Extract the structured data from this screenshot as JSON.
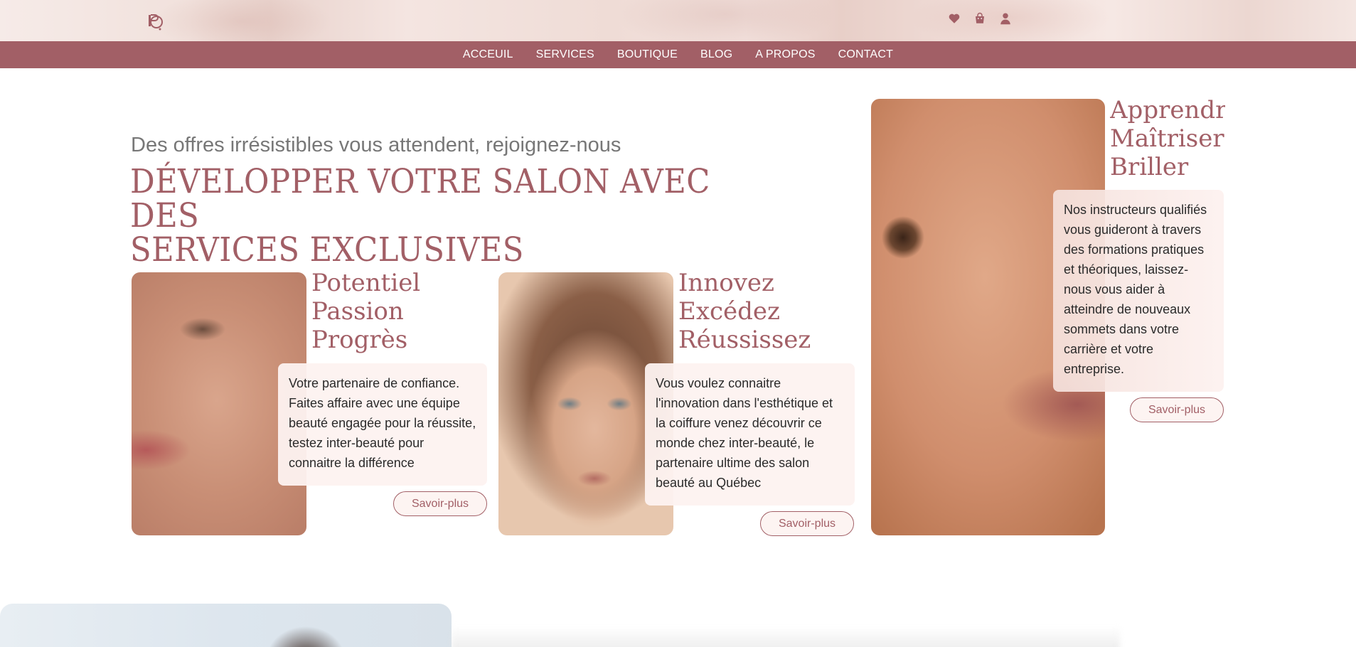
{
  "header": {
    "logo_icon": "logo-icon",
    "icons": [
      "heart-icon",
      "shopping-bag-icon",
      "user-icon"
    ]
  },
  "nav": {
    "items": [
      {
        "label": "ACCEUIL"
      },
      {
        "label": "SERVICES"
      },
      {
        "label": "BOUTIQUE"
      },
      {
        "label": "BLOG"
      },
      {
        "label": "A PROPOS"
      },
      {
        "label": "CONTACT"
      }
    ]
  },
  "hero": {
    "subtitle": "Des offres irrésistibles vous attendent, rejoignez-nous",
    "headline_line1": "DÉVELOPPER VOTRE SALON AVEC DES",
    "headline_line2": "SERVICES EXCLUSIVES"
  },
  "cards": [
    {
      "title_lines": [
        "Potentiel",
        "Passion",
        "Progrès"
      ],
      "text": "Votre partenaire de confiance. Faites affaire avec une équipe beauté engagée pour la réussite, testez inter-beauté pour connaitre la différence",
      "button": "Savoir-plus"
    },
    {
      "title_lines": [
        "Innovez",
        "Excédez",
        "Réussissez"
      ],
      "text": "Vous voulez connaitre l'innovation dans l'esthétique et la coiffure venez découvrir ce monde chez inter-beauté, le partenaire ultime des salon beauté au Québec",
      "button": "Savoir-plus"
    },
    {
      "title_lines": [
        "Apprendre",
        "Maîtriser",
        "Briller"
      ],
      "text": "Nos instructeurs qualifiés vous guideront à travers des formations pratiques et théoriques, laissez-nous vous aider à atteindre de nouveaux sommets dans votre carrière et votre entreprise.",
      "button": "Savoir-plus"
    }
  ],
  "colors": {
    "accent": "#a25f66",
    "box_bg": "#fdf2f0"
  }
}
